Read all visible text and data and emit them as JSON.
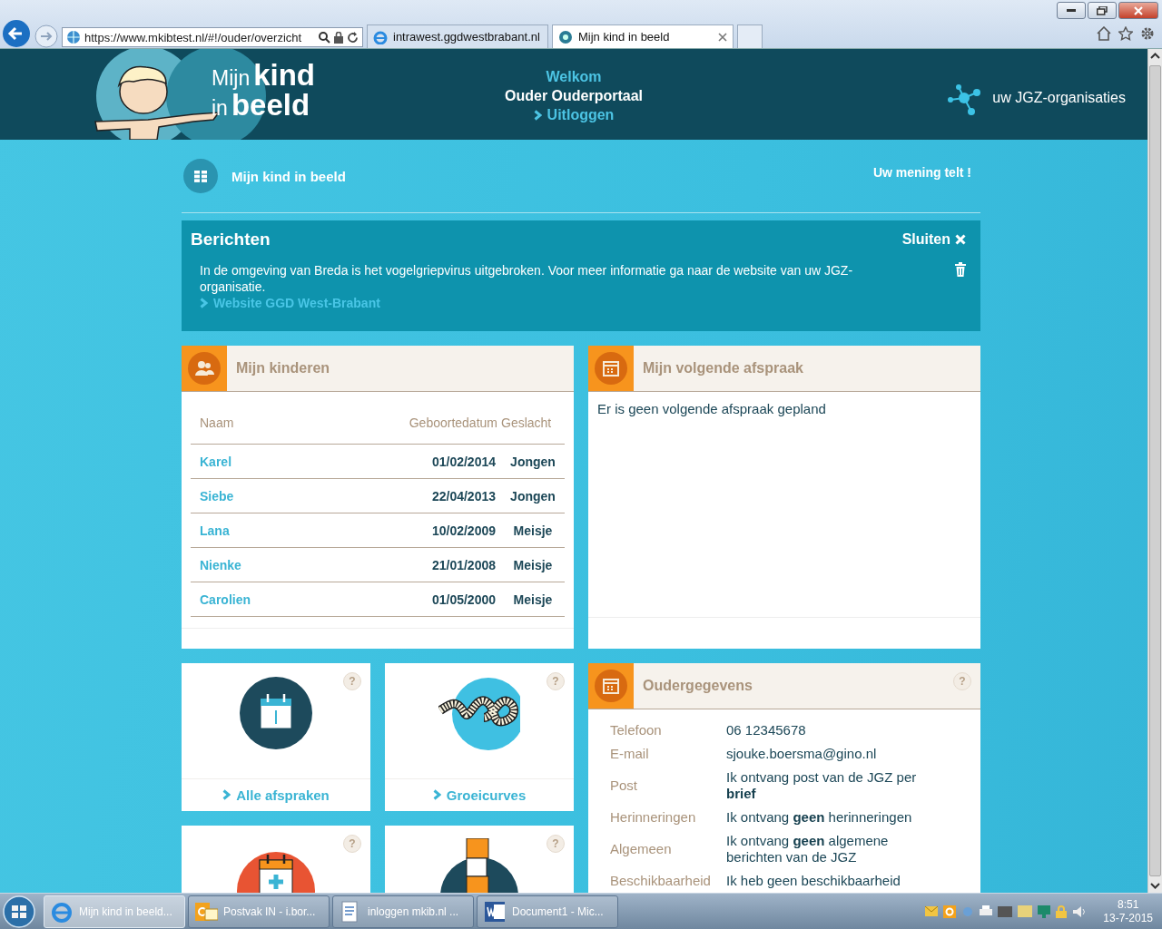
{
  "browser": {
    "address": "https://www.mkibtest.nl/#!/ouder/overzicht",
    "tabs": [
      {
        "label": "intrawest.ggdwestbrabant.nl",
        "selected": false
      },
      {
        "label": "Mijn kind in beeld",
        "selected": true
      }
    ]
  },
  "header": {
    "logo": [
      "Mijn",
      "kind",
      "in",
      "beeld"
    ],
    "welcome": "Welkom",
    "user": "Ouder Ouderportaal",
    "logout": "Uitloggen",
    "org": "uw JGZ-organisaties"
  },
  "breadcrumb": "Mijn kind in beeld",
  "feedback": "Uw mening telt !",
  "messages": {
    "title": "Berichten",
    "close": "Sluiten",
    "text": "In de omgeving van Breda is het vogelgriepvirus uitgebroken. Voor meer informatie ga naar de website van uw JGZ-organisatie.",
    "link": "Website GGD West-Brabant"
  },
  "children_panel": {
    "title": "Mijn kinderen",
    "columns": [
      "Naam",
      "Geboortedatum",
      "Geslacht"
    ],
    "rows": [
      {
        "name": "Karel",
        "birth": "01/02/2014",
        "gender": "Jongen"
      },
      {
        "name": "Siebe",
        "birth": "22/04/2013",
        "gender": "Jongen"
      },
      {
        "name": "Lana",
        "birth": "10/02/2009",
        "gender": "Meisje"
      },
      {
        "name": "Nienke",
        "birth": "21/01/2008",
        "gender": "Meisje"
      },
      {
        "name": "Carolien",
        "birth": "01/05/2000",
        "gender": "Meisje"
      }
    ]
  },
  "appointment_panel": {
    "title": "Mijn volgende afspraak",
    "text": "Er is geen volgende afspraak gepland"
  },
  "tiles": [
    {
      "kind": "calendar",
      "label": "Alle afspraken",
      "help": "?"
    },
    {
      "kind": "tape",
      "label": "Groeicurves",
      "help": "?"
    },
    {
      "kind": "calendar-plus",
      "help": "?"
    },
    {
      "kind": "blocks",
      "help": "?"
    }
  ],
  "parent_panel": {
    "title": "Oudergegevens",
    "help": "?",
    "rows": [
      {
        "label": "Telefoon",
        "value": "06 12345678"
      },
      {
        "label": "E-mail",
        "value": "sjouke.boersma@gino.nl"
      },
      {
        "label": "Post",
        "value": "Ik ontvang post van de JGZ per **brief**"
      },
      {
        "label": "Herinneringen",
        "value": "Ik ontvang **geen** herinneringen"
      },
      {
        "label": "Algemeen",
        "value": "Ik ontvang **geen** algemene berichten van de JGZ"
      },
      {
        "label": "Beschikbaarheid",
        "value": "Ik heb geen beschikbaarheid"
      }
    ]
  },
  "taskbar": {
    "items": [
      {
        "kind": "ie",
        "label": "Mijn kind in beeld...",
        "selected": true
      },
      {
        "kind": "outlook",
        "label": "Postvak IN - i.bor...",
        "selected": false
      },
      {
        "kind": "doc",
        "label": "inloggen mkib.nl ...",
        "selected": false
      },
      {
        "kind": "word",
        "label": "Document1 - Mic...",
        "selected": false
      }
    ],
    "time": "8:51",
    "date": "13-7-2015"
  }
}
